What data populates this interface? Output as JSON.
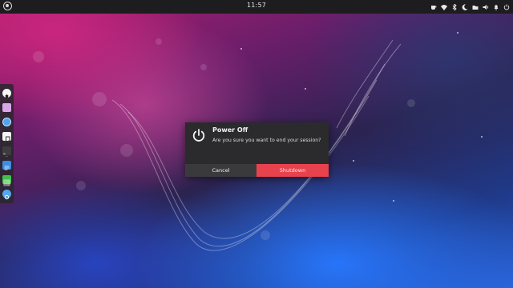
{
  "top_panel": {
    "clock": "11:57",
    "tray_icons": [
      "cup-icon",
      "wifi-icon",
      "bluetooth-icon",
      "moon-icon",
      "folder-icon",
      "volume-icon",
      "bell-icon",
      "power-icon"
    ]
  },
  "dock": {
    "items": [
      {
        "icon": "soccer-ball-icon",
        "color": "#f5f5f5"
      },
      {
        "icon": "folder-icon",
        "color": "#d9a7e8"
      },
      {
        "icon": "browser-icon",
        "color": "#4ea4f0"
      },
      {
        "icon": "music-icon",
        "color": "#f5f5f5"
      },
      {
        "icon": "terminal-icon",
        "color": "#3d3d3d"
      },
      {
        "icon": "document-icon",
        "color": "#3a8ee6"
      },
      {
        "icon": "spreadsheet-icon",
        "color": "#43c04a"
      },
      {
        "icon": "settings-icon",
        "color": "#58a6f0"
      }
    ]
  },
  "dialog": {
    "title": "Power Off",
    "message": "Are you sure you want to end your session?",
    "cancel_label": "Cancel",
    "confirm_label": "Shutdown",
    "confirm_color": "#e8424d"
  }
}
